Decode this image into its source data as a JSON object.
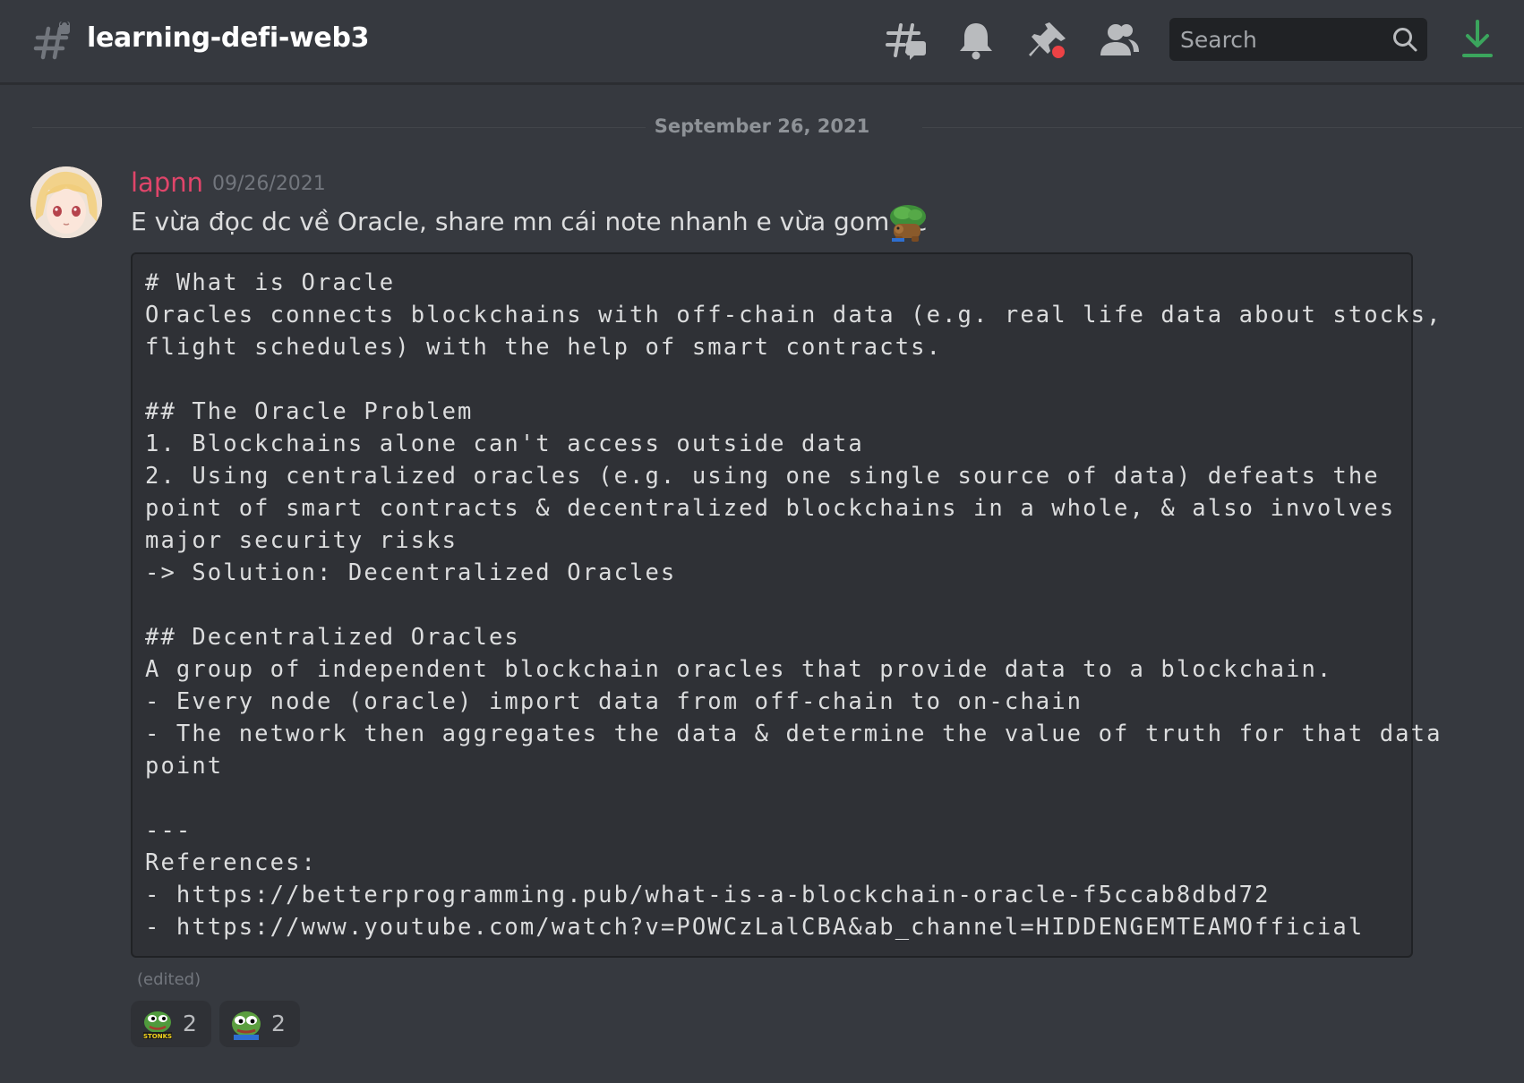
{
  "header": {
    "channel_name": "learning-defi-web3",
    "search_placeholder": "Search",
    "icons": [
      "hashtag-icon",
      "threads-icon",
      "bell-icon",
      "pin-icon",
      "members-icon",
      "search-icon",
      "download-icon"
    ],
    "colors": {
      "download": "#3ba55d",
      "pin_dot": "#ed4245"
    }
  },
  "date_divider": "September 26, 2021",
  "message": {
    "author": "lapnn",
    "author_color": "#e0456a",
    "timestamp": "09/26/2021",
    "text": "E vừa đọc dc về Oracle, share mn cái note nhanh e vừa gom dc",
    "inline_emoji": "turtle-tree-emoji",
    "code": "# What is Oracle\nOracles connects blockchains with off-chain data (e.g. real life data about stocks,\nflight schedules) with the help of smart contracts.\n\n## The Oracle Problem\n1. Blockchains alone can't access outside data\n2. Using centralized oracles (e.g. using one single source of data) defeats the\npoint of smart contracts & decentralized blockchains in a whole, & also involves\nmajor security risks\n-> Solution: Decentralized Oracles\n\n## Decentralized Oracles\nA group of independent blockchain oracles that provide data to a blockchain.\n- Every node (oracle) import data from off-chain to on-chain\n- The network then aggregates the data & determine the value of truth for that data\npoint\n\n---\nReferences:\n- https://betterprogramming.pub/what-is-a-blockchain-oracle-f5ccab8dbd72\n- https://www.youtube.com/watch?v=POWCzLalCBA&ab_channel=HIDDENGEMTEAMOfficial",
    "edited_label": "(edited)",
    "reactions": [
      {
        "emoji": "stonks-pepe-emoji",
        "count": "2"
      },
      {
        "emoji": "pepe-emoji",
        "count": "2"
      }
    ]
  }
}
